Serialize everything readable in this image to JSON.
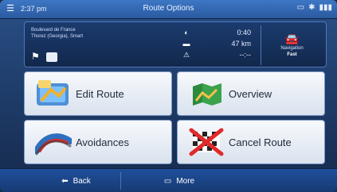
{
  "statusbar": {
    "time": "2:37 pm",
    "title": "Route Options",
    "right_icons": [
      "sim-icon",
      "bluetooth-icon",
      "signal-icon"
    ]
  },
  "info": {
    "destination_line1": "Boulevard de France",
    "destination_line2": "Thorez (Georgia), Smart",
    "stats": [
      {
        "icon": "moon-icon",
        "value": "0:40"
      },
      {
        "icon": "road-icon",
        "value": "47 km"
      },
      {
        "icon": "warning-icon",
        "value": "--:--"
      }
    ],
    "navigation": {
      "label": "Navigation",
      "value": "Fast"
    }
  },
  "buttons": [
    {
      "name": "edit-route-button",
      "label": "Edit Route",
      "icon": "edit-route-icon"
    },
    {
      "name": "overview-button",
      "label": "Overview",
      "icon": "map-overview-icon"
    },
    {
      "name": "avoidances-button",
      "label": "Avoidances",
      "icon": "avoid-road-icon"
    },
    {
      "name": "cancel-route-button",
      "label": "Cancel Route",
      "icon": "cancel-route-icon"
    }
  ],
  "bottombar": {
    "back_label": "Back",
    "more_label": "More"
  },
  "colors": {
    "titlebar": "#2a5aa0",
    "panel": "#12284c",
    "button_light": "#f7f9fc",
    "button_text": "#1f2a3a"
  }
}
